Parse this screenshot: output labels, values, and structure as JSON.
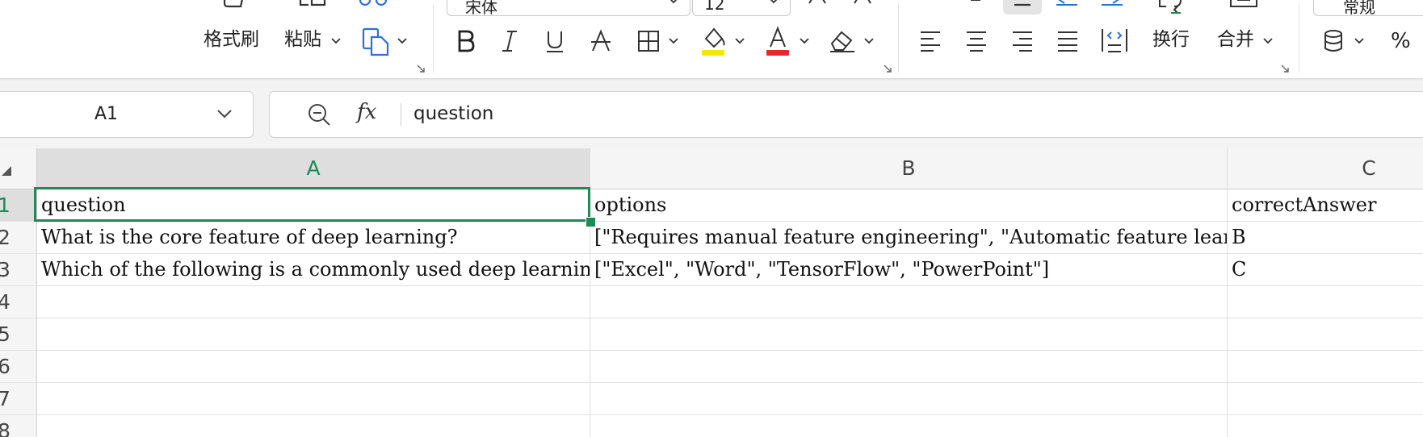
{
  "ribbon": {
    "font_name": "宋体",
    "font_size": "12",
    "number_format": "常规",
    "format_painter_label": "格式刷",
    "paste_label": "粘贴",
    "wrap_label": "换行",
    "merge_label": "合并",
    "percent_label": "%",
    "italic_letter": "I",
    "underline_letter": "U",
    "font_color_letter": "A",
    "highlight_color": "#f5e800",
    "font_color": "#e8262e"
  },
  "name_box": {
    "value": "A1"
  },
  "formula_bar": {
    "fx_label": "fx",
    "content": "question"
  },
  "accent_color": "#1f8a57",
  "columns": [
    "A",
    "B",
    "C"
  ],
  "rows": [
    "1",
    "2",
    "3",
    "4",
    "5",
    "6",
    "7",
    "8"
  ],
  "cells": {
    "A1": "question",
    "B1": "options",
    "C1": "correctAnswer",
    "A2": "What is the core feature of deep learning?",
    "B2": "[\"Requires manual feature engineering\", \"Automatic feature learning\", \"Works only with small datasets\", \"Cannot process images\"]",
    "C2": "B",
    "A3": "Which of the following is a commonly used deep learning framework?",
    "B3": "[\"Excel\", \"Word\", \"TensorFlow\", \"PowerPoint\"]",
    "C3": "C"
  }
}
